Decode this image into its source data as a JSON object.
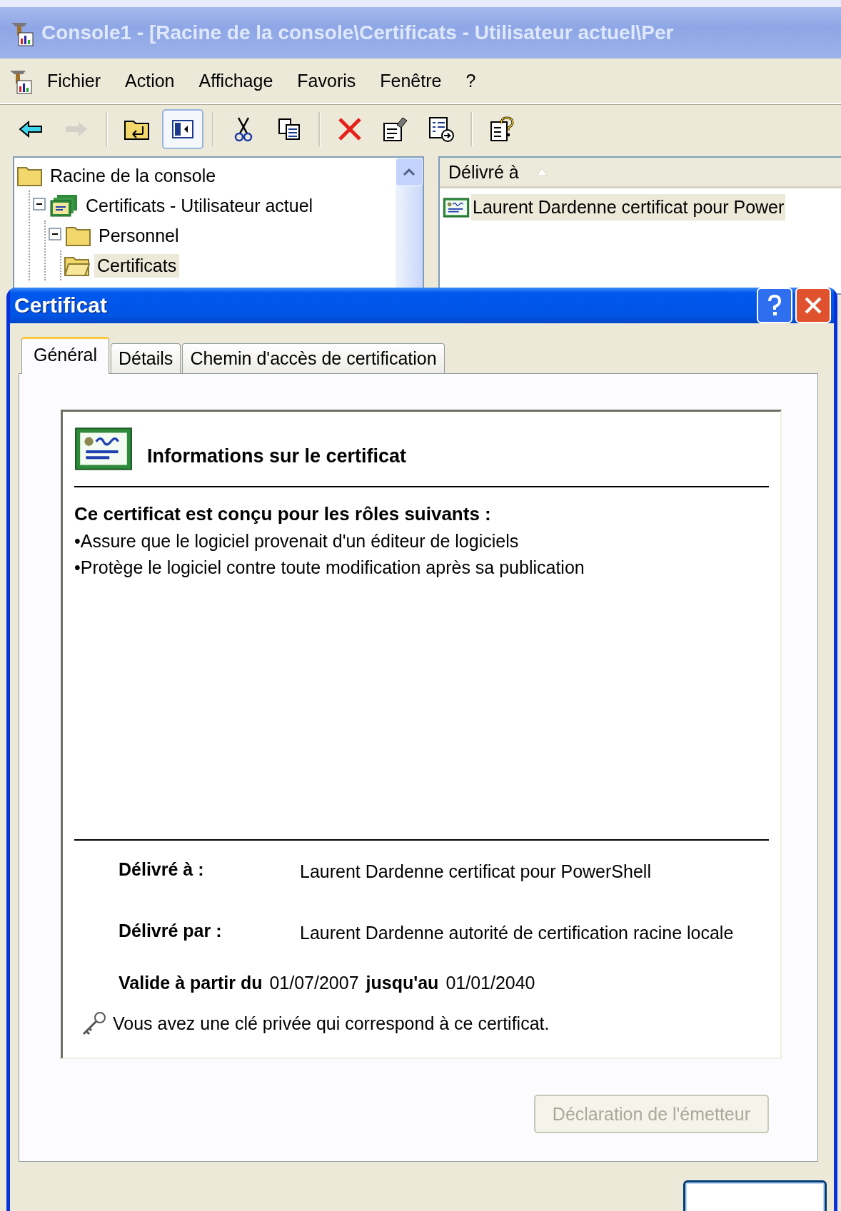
{
  "console": {
    "title": "Console1 - [Racine de la console\\Certificats - Utilisateur actuel\\Per",
    "menu": [
      "Fichier",
      "Action",
      "Affichage",
      "Favoris",
      "Fenêtre",
      "?"
    ],
    "toolbar": [
      [
        {
          "kind": "back",
          "pressed": false,
          "disabled": false
        },
        {
          "kind": "forward",
          "pressed": false,
          "disabled": true
        }
      ],
      [
        {
          "kind": "up",
          "pressed": false,
          "disabled": false
        },
        {
          "kind": "tree",
          "pressed": true,
          "disabled": false
        }
      ],
      [
        {
          "kind": "cut",
          "pressed": false,
          "disabled": false
        },
        {
          "kind": "copy",
          "pressed": false,
          "disabled": false
        }
      ],
      [
        {
          "kind": "delete",
          "pressed": false,
          "disabled": false
        },
        {
          "kind": "properties",
          "pressed": false,
          "disabled": false
        },
        {
          "kind": "export",
          "pressed": false,
          "disabled": false
        }
      ],
      [
        {
          "kind": "help",
          "pressed": false,
          "disabled": false
        }
      ]
    ],
    "tree": [
      {
        "label": "Racine de la console",
        "kind": "root",
        "selected": false,
        "children": [
          {
            "label": "Certificats - Utilisateur actuel",
            "kind": "store",
            "selected": false,
            "expanded": true,
            "children": [
              {
                "label": "Personnel",
                "kind": "folder",
                "selected": false,
                "expanded": true,
                "children": [
                  {
                    "label": "Certificats",
                    "kind": "open-folder",
                    "selected": true
                  }
                ]
              }
            ]
          }
        ]
      }
    ],
    "list": {
      "columns": [
        "Délivré à"
      ],
      "rows": [
        {
          "cells": [
            "Laurent Dardenne certificat pour Power"
          ],
          "selected": true
        }
      ]
    }
  },
  "dialog": {
    "title": "Certificat",
    "tabs": [
      {
        "label": "Général",
        "selected": true
      },
      {
        "label": "Détails",
        "selected": false
      },
      {
        "label": "Chemin d'accès de certification",
        "selected": false
      }
    ],
    "header": "Informations sur le certificat",
    "purposes_heading": "Ce certificat est conçu pour les rôles suivants :",
    "purposes": [
      "•Assure que le logiciel provenait d'un éditeur de logiciels",
      "•Protège le logiciel contre toute modification après sa publication"
    ],
    "fields": [
      {
        "label": "Délivré à :",
        "value": "Laurent Dardenne certificat pour PowerShell"
      },
      {
        "label": "Délivré par :",
        "value": "Laurent Dardenne autorité de certification racine locale"
      }
    ],
    "validity": {
      "from_label": "Valide à partir du",
      "from": "01/07/2007",
      "to_label": "jusqu'au",
      "to": "01/01/2040"
    },
    "key_note": "Vous avez une clé privée qui correspond à ce certificat.",
    "issuer_button": {
      "label": "Déclaration de l'émetteur",
      "disabled": true
    }
  }
}
